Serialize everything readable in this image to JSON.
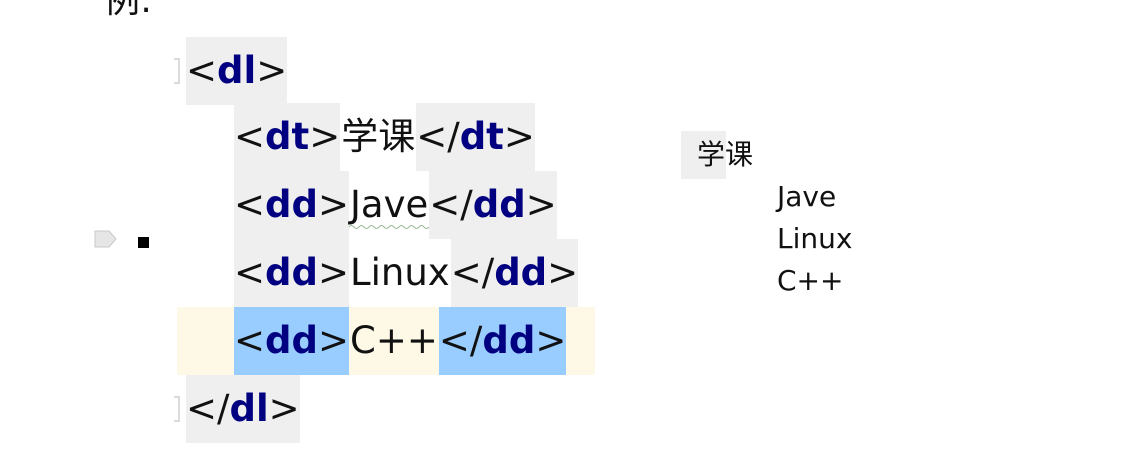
{
  "intro": {
    "text": "例:"
  },
  "code": {
    "open_bracket": "<",
    "close_bracket": ">",
    "end_bracket": "</",
    "dl_tag": "dl",
    "dt_tag": "dt",
    "dd_tag": "dd",
    "dt_text": "学课",
    "dd_items": [
      "Jave",
      "Linux",
      "C++"
    ]
  },
  "preview": {
    "term": "学课",
    "items": [
      "Jave",
      "Linux",
      "C++"
    ]
  },
  "colors": {
    "tag_name": "#000080",
    "tag_bg": "#efefef",
    "selection": "#99ccff",
    "current_line": "#fdf9e6"
  },
  "icons": [
    "arrow-marker-icon",
    "fold-icon",
    "spellcheck-squiggle-icon"
  ]
}
